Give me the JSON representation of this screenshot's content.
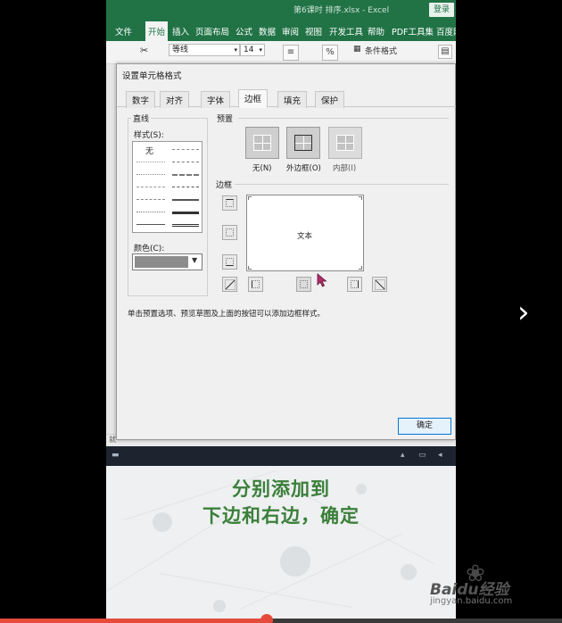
{
  "excel": {
    "title": "第6课时 排序.xlsx - Excel",
    "login": "登录",
    "tabs": [
      "文件",
      "开始",
      "插入",
      "页面布局",
      "公式",
      "数据",
      "审阅",
      "视图",
      "开发工具",
      "帮助",
      "PDF工具集",
      "百度网"
    ],
    "active_tab": "开始",
    "font_name": "等线",
    "font_size": "14",
    "percent_icon": "%",
    "conditional_format": "条件格式",
    "status_left": "就"
  },
  "dialog": {
    "title": "设置单元格格式",
    "tabs": [
      "数字",
      "对齐",
      "字体",
      "边框",
      "填充",
      "保护"
    ],
    "active_tab": "边框",
    "line_section": "直线",
    "style_label": "样式(S):",
    "style_none": "无",
    "color_label": "颜色(C):",
    "color_value": "#8c8c8c",
    "preset_section": "预置",
    "presets": [
      "无(N)",
      "外边框(O)",
      "内部(I)"
    ],
    "border_section": "边框",
    "preview_text": "文本",
    "hint": "单击预置选项、预览草图及上面的按钮可以添加边框样式。",
    "ok_button": "确定"
  },
  "caption": {
    "line1": "分别添加到",
    "line2": "下边和右边，确定",
    "color": "#3a7f3a"
  },
  "watermark": {
    "brand": "Baidu经验",
    "url": "jingyan.baidu.com"
  },
  "player": {
    "next_icon": "chevron-right-icon",
    "progress": 0.475
  }
}
